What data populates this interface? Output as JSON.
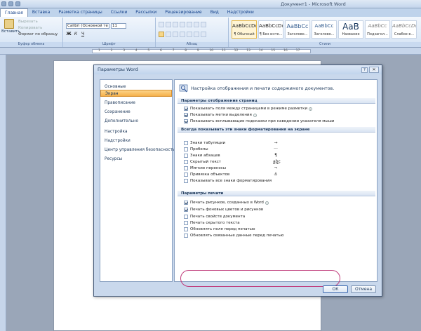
{
  "app": {
    "title": "Документ1 - Microsoft Word"
  },
  "ribbon_tabs": [
    {
      "label": "Главная",
      "active": true
    },
    {
      "label": "Вставка"
    },
    {
      "label": "Разметка страницы"
    },
    {
      "label": "Ссылки"
    },
    {
      "label": "Рассылки"
    },
    {
      "label": "Рецензирование"
    },
    {
      "label": "Вид"
    },
    {
      "label": "Надстройки"
    }
  ],
  "ribbon": {
    "clipboard": {
      "paste": "Вставить",
      "cut": "Вырезать",
      "copy": "Копировать",
      "format_painter": "Формат по образцу",
      "label": "Буфер обмена"
    },
    "font": {
      "name": "Calibri (Основной те",
      "size": "11",
      "label": "Шрифт",
      "bold": "Ж",
      "italic": "К",
      "underline": "Ч"
    },
    "paragraph": {
      "label": "Абзац"
    },
    "styles": {
      "label": "Стили",
      "items": [
        {
          "sample": "AaBbCcDc",
          "name": "¶ Обычный"
        },
        {
          "sample": "AaBbCcDc",
          "name": "¶ Без инте..."
        },
        {
          "sample": "AaBbCc",
          "name": "Заголово..."
        },
        {
          "sample": "AaBbCc",
          "name": "Заголово..."
        },
        {
          "sample": "AaB",
          "name": "Название"
        },
        {
          "sample": "AaBbCc",
          "name": "Подзагол..."
        },
        {
          "sample": "AaBbCcDc",
          "name": "Слабое в..."
        }
      ]
    }
  },
  "ruler": {
    "ticks": [
      "1",
      "2",
      "3",
      "4",
      "5",
      "6",
      "7",
      "8",
      "9",
      "10",
      "11",
      "12",
      "13",
      "14",
      "15",
      "16",
      "17"
    ]
  },
  "dialog": {
    "title": "Параметры Word",
    "help": "?",
    "close": "✕",
    "nav": [
      {
        "label": "Основные"
      },
      {
        "label": "Экран",
        "active": true
      },
      {
        "label": "Правописание"
      },
      {
        "label": "Сохранение"
      },
      {
        "label": "Дополнительно"
      },
      {
        "label": "Настройка"
      },
      {
        "label": "Надстройки"
      },
      {
        "label": "Центр управления безопасностью"
      },
      {
        "label": "Ресурсы"
      }
    ],
    "header": "Настройка отображения и печати содержимого документов.",
    "sections": {
      "page_display": {
        "title": "Параметры отображения страниц",
        "options": [
          {
            "label": "Показывать поля между страницами в режиме разметки",
            "checked": true,
            "info": true
          },
          {
            "label": "Показывать метки выделения",
            "checked": true,
            "info": true
          },
          {
            "label": "Показывать всплывающие подсказки при наведении указателя мыши",
            "checked": true
          }
        ]
      },
      "formatting_marks": {
        "title": "Всегда показывать эти знаки форматирования на экране",
        "options": [
          {
            "label": "Знаки табуляции",
            "glyph": "→",
            "checked": false
          },
          {
            "label": "Пробелы",
            "glyph": "···",
            "checked": false
          },
          {
            "label": "Знаки абзацев",
            "glyph": "¶",
            "checked": false
          },
          {
            "label": "Скрытый текст",
            "glyph": "abc",
            "checked": false
          },
          {
            "label": "Мягкие переносы",
            "glyph": "¬",
            "checked": false
          },
          {
            "label": "Привязка объектов",
            "glyph": "⚓",
            "checked": false
          },
          {
            "label": "Показывать все знаки форматирования",
            "checked": false
          }
        ]
      },
      "printing": {
        "title": "Параметры печати",
        "options": [
          {
            "label": "Печать рисунков, созданных в Word",
            "checked": true,
            "info": true
          },
          {
            "label": "Печать фоновых цветов и рисунков",
            "checked": true
          },
          {
            "label": "Печать свойств документа",
            "checked": false
          },
          {
            "label": "Печать скрытого текста",
            "checked": false
          },
          {
            "label": "Обновлять поля перед печатью",
            "checked": false
          },
          {
            "label": "Обновлять связанные данные перед печатью",
            "checked": false
          }
        ]
      }
    },
    "buttons": {
      "ok": "ОК",
      "cancel": "Отмена"
    }
  },
  "colors": {
    "ribbon_blue": "#bfd3eb",
    "active_nav": "#f6b04a",
    "highlight_oval": "#c03a7a",
    "workspace": "#9aa6b8"
  }
}
